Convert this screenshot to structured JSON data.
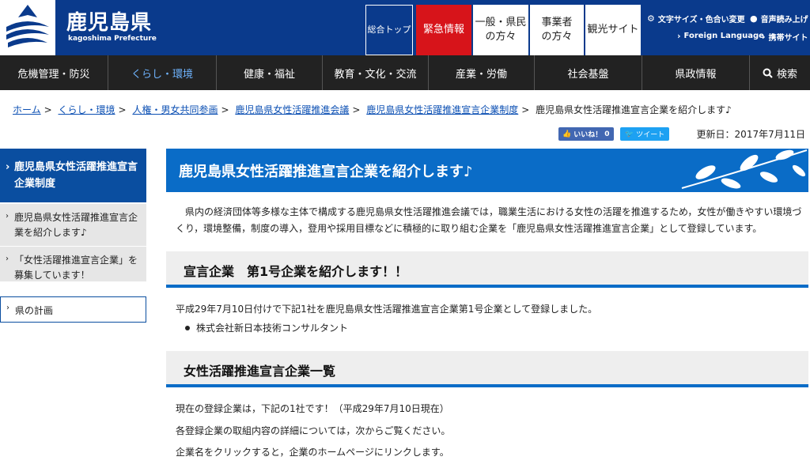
{
  "header": {
    "logo_title": "鹿児島県",
    "logo_sub": "kagoshima Prefecture",
    "buttons": {
      "top": "総合トップ",
      "emergency": "緊急情報",
      "residents_l1": "一般・県民",
      "residents_l2": "の方々",
      "business_l1": "事業者",
      "business_l2": "の方々",
      "tourism": "観光サイト"
    },
    "util": {
      "text_size": "文字サイズ・色合い変更",
      "read_aloud": "音声読み上げ",
      "foreign": "Foreign Language",
      "mobile": "携帯サイト"
    }
  },
  "nav": {
    "items": [
      "危機管理・防災",
      "くらし・環境",
      "健康・福祉",
      "教育・文化・交流",
      "産業・労働",
      "社会基盤",
      "県政情報"
    ],
    "search": "検索"
  },
  "breadcrumb": {
    "links": [
      "ホーム",
      "くらし・環境",
      "人権・男女共同参画",
      "鹿児島県女性活躍推進会議",
      "鹿児島県女性活躍推進宣言企業制度"
    ],
    "current": "鹿児島県女性活躍推進宣言企業を紹介します♪"
  },
  "social": {
    "like_label": "いいね！",
    "like_count": "0",
    "tweet_label": "ツイート"
  },
  "updated": "更新日：2017年7月11日",
  "sidebar": {
    "head": "鹿児島県女性活躍推進宣言企業制度",
    "items": [
      "鹿児島県女性活躍推進宣言企業を紹介します♪",
      "「女性活躍推進宣言企業」を募集しています！"
    ],
    "plan": "県の計画"
  },
  "main": {
    "title": "鹿児島県女性活躍推進宣言企業を紹介します♪",
    "intro": "県内の経済団体等多様な主体で構成する鹿児島県女性活躍推進会議では，職業生活における女性の活躍を推進するため，女性が働きやすい環境づくり，環境整備，制度の導入，登用や採用目標などに積極的に取り組む企業を「鹿児島県女性活躍推進宣言企業」として登録しています。",
    "section1": {
      "heading": "宣言企業　第1号企業を紹介します！！",
      "text": "平成29年7月10日付けで下記1社を鹿児島県女性活躍推進宣言企業第1号企業として登録しました。",
      "bullet": "株式会社新日本技術コンサルタント"
    },
    "section2": {
      "heading": "女性活躍推進宣言企業一覧",
      "line1": "現在の登録企業は，下記の1社です！（平成29年7月10日現在）",
      "line2": "各登録企業の取組内容の詳細については，次からご覧ください。",
      "line3": "企業名をクリックすると，企業のホームページにリンクします。"
    }
  },
  "colors": {
    "header_bg": "#0a3a8c",
    "emergency": "#d7141a",
    "nav_bg": "#222222",
    "accent": "#0a6cc7"
  }
}
